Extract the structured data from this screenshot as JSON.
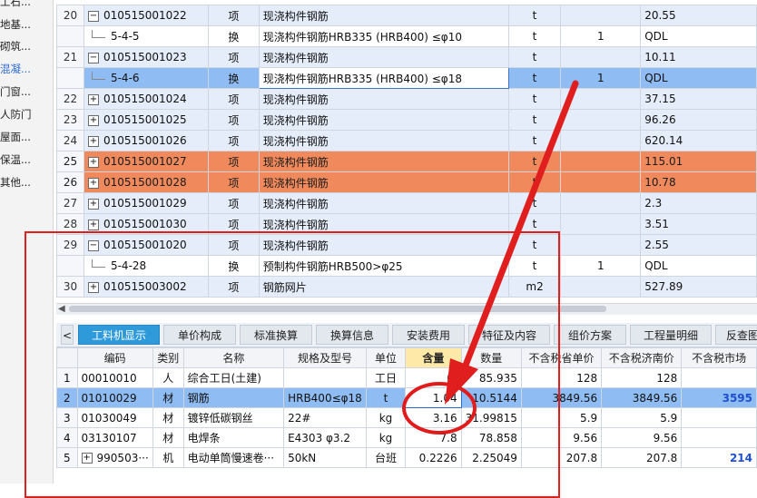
{
  "left_nav": [
    "工石...",
    "地基...",
    "砌筑...",
    "混凝...",
    "门窗...",
    "人防门",
    "屋面...",
    "保温...",
    "其他..."
  ],
  "upper_rows": [
    {
      "num": "20",
      "code": "010515001022",
      "sign": "−",
      "type": "项",
      "name": "现浇构件钢筋",
      "unit": "t",
      "qty": "",
      "val": "20.55",
      "style": "blue"
    },
    {
      "num": "",
      "code": "5-4-5",
      "sign": "",
      "type": "换",
      "name": "现浇构件钢筋HRB335 (HRB400) ≤φ10",
      "unit": "t",
      "qty": "1",
      "val": "QDL",
      "style": "white"
    },
    {
      "num": "21",
      "code": "010515001023",
      "sign": "−",
      "type": "项",
      "name": "现浇构件钢筋",
      "unit": "t",
      "qty": "",
      "val": "10.11",
      "style": "blue"
    },
    {
      "num": "",
      "code": "5-4-6",
      "sign": "",
      "type": "换",
      "name": "现浇构件钢筋HRB335 (HRB400) ≤φ18",
      "unit": "t",
      "qty": "1",
      "val": "QDL",
      "style": "sel"
    },
    {
      "num": "22",
      "code": "010515001024",
      "sign": "+",
      "type": "项",
      "name": "现浇构件钢筋",
      "unit": "t",
      "qty": "",
      "val": "37.15",
      "style": "blue"
    },
    {
      "num": "23",
      "code": "010515001025",
      "sign": "+",
      "type": "项",
      "name": "现浇构件钢筋",
      "unit": "t",
      "qty": "",
      "val": "96.26",
      "style": "blue"
    },
    {
      "num": "24",
      "code": "010515001026",
      "sign": "+",
      "type": "项",
      "name": "现浇构件钢筋",
      "unit": "t",
      "qty": "",
      "val": "620.14",
      "style": "blue"
    },
    {
      "num": "25",
      "code": "010515001027",
      "sign": "+",
      "type": "项",
      "name": "现浇构件钢筋",
      "unit": "t",
      "qty": "",
      "val": "115.01",
      "style": "orange"
    },
    {
      "num": "26",
      "code": "010515001028",
      "sign": "+",
      "type": "项",
      "name": "现浇构件钢筋",
      "unit": "t",
      "qty": "",
      "val": "10.78",
      "style": "orange"
    },
    {
      "num": "27",
      "code": "010515001029",
      "sign": "+",
      "type": "项",
      "name": "现浇构件钢筋",
      "unit": "t",
      "qty": "",
      "val": "2.3",
      "style": "blue"
    },
    {
      "num": "28",
      "code": "010515001030",
      "sign": "+",
      "type": "项",
      "name": "现浇构件钢筋",
      "unit": "t",
      "qty": "",
      "val": "3.51",
      "style": "blue"
    },
    {
      "num": "29",
      "code": "010515001020",
      "sign": "−",
      "type": "项",
      "name": "现浇构件钢筋",
      "unit": "t",
      "qty": "",
      "val": "2.55",
      "style": "blue"
    },
    {
      "num": "",
      "code": "5-4-28",
      "sign": "",
      "type": "换",
      "name": "预制构件钢筋HRB500>φ25",
      "unit": "t",
      "qty": "1",
      "val": "QDL",
      "style": "white"
    },
    {
      "num": "30",
      "code": "010515003002",
      "sign": "+",
      "type": "项",
      "name": "钢筋网片",
      "unit": "m2",
      "qty": "",
      "val": "527.89",
      "style": "blue"
    }
  ],
  "tabs": [
    "工料机显示",
    "单价构成",
    "标准换算",
    "换算信息",
    "安装费用",
    "特征及内容",
    "组价方案",
    "工程量明细",
    "反查图"
  ],
  "lower_headers": [
    "",
    "编码",
    "类别",
    "名称",
    "规格及型号",
    "单位",
    "含量",
    "数量",
    "不含税省单价",
    "不含税济南价",
    "不含税市场"
  ],
  "lower_rows": [
    {
      "n": "1",
      "code": "00010010",
      "cat": "人",
      "name": "综合工日(土建)",
      "spec": "",
      "unit": "工日",
      "qty": "0.",
      "amt": "85.935",
      "p1": "128",
      "p2": "128",
      "p3": "",
      "sel": false
    },
    {
      "n": "2",
      "code": "01010029",
      "cat": "材",
      "name": "钢筋",
      "spec": "HRB400≤φ18",
      "unit": "t",
      "qty": "1.04",
      "amt": "10.5144",
      "p1": "3849.56",
      "p2": "3849.56",
      "p3": "3595",
      "sel": true
    },
    {
      "n": "3",
      "code": "01030049",
      "cat": "材",
      "name": "镀锌低碳钢丝",
      "spec": "22#",
      "unit": "kg",
      "qty": "3.16",
      "amt": "31.99815",
      "p1": "5.9",
      "p2": "5.9",
      "p3": "",
      "sel": false
    },
    {
      "n": "4",
      "code": "03130107",
      "cat": "材",
      "name": "电焊条",
      "spec": "E4303 φ3.2",
      "unit": "kg",
      "qty": "7.8",
      "amt": "78.858",
      "p1": "9.56",
      "p2": "9.56",
      "p3": "",
      "sel": false
    },
    {
      "n": "5",
      "code": "990503···",
      "cat": "机",
      "name": "电动单筒慢速卷···",
      "spec": "50kN",
      "unit": "台班",
      "qty": "0.2226",
      "amt": "2.25049",
      "p1": "207.8",
      "p2": "207.8",
      "p3": "214",
      "sel": false
    }
  ]
}
